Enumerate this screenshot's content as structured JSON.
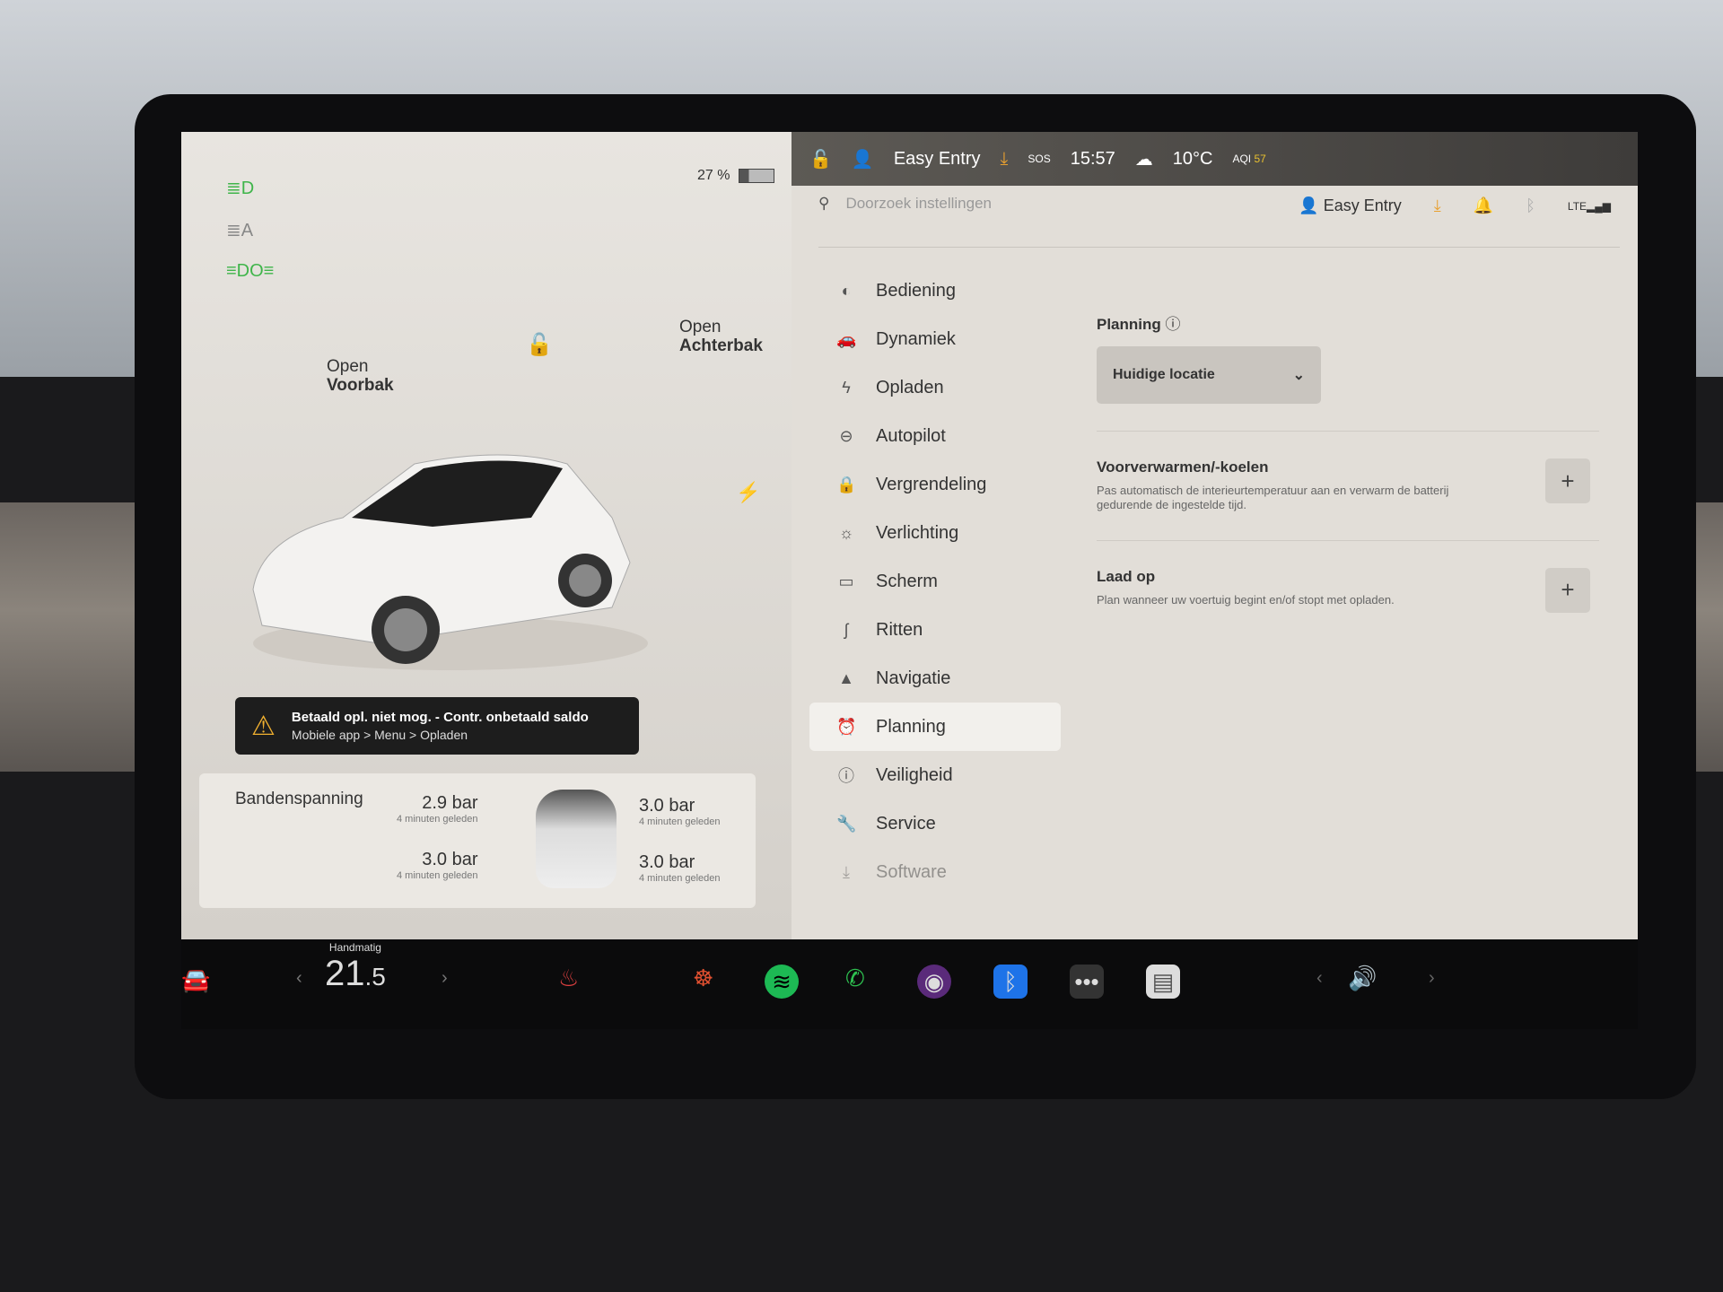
{
  "status": {
    "battery_percent": "27 %",
    "battery_level": 0.27,
    "profile": "Easy Entry",
    "sos": "SOS",
    "time": "15:57",
    "temperature": "10°C",
    "aqi_label": "AQI",
    "aqi_value": "57"
  },
  "search": {
    "placeholder": "Doorzoek instellingen"
  },
  "header": {
    "profile": "Easy Entry"
  },
  "menu": [
    {
      "label": "Bediening",
      "icon": "toggle-icon"
    },
    {
      "label": "Dynamiek",
      "icon": "car-icon"
    },
    {
      "label": "Opladen",
      "icon": "bolt-icon"
    },
    {
      "label": "Autopilot",
      "icon": "steering-wheel-icon"
    },
    {
      "label": "Vergrendeling",
      "icon": "lock-icon"
    },
    {
      "label": "Verlichting",
      "icon": "sun-icon"
    },
    {
      "label": "Scherm",
      "icon": "display-icon"
    },
    {
      "label": "Ritten",
      "icon": "trips-icon"
    },
    {
      "label": "Navigatie",
      "icon": "navigation-icon"
    },
    {
      "label": "Planning",
      "icon": "clock-icon",
      "active": true
    },
    {
      "label": "Veiligheid",
      "icon": "info-circle-icon"
    },
    {
      "label": "Service",
      "icon": "wrench-icon"
    },
    {
      "label": "Software",
      "icon": "download-icon"
    }
  ],
  "planning": {
    "title": "Planning",
    "location": "Huidige locatie",
    "precondition": {
      "title": "Voorverwarmen/-koelen",
      "desc": "Pas automatisch de interieurtemperatuur aan en verwarm de batterij gedurende de ingestelde tijd."
    },
    "charge": {
      "title": "Laad op",
      "desc": "Plan wanneer uw voertuig begint en/of stopt met opladen."
    }
  },
  "car": {
    "frunk_open": "Open",
    "frunk": "Voorbak",
    "trunk_open": "Open",
    "trunk": "Achterbak"
  },
  "alert": {
    "line1": "Betaald opl. niet mog. - Contr. onbetaald saldo",
    "line2": "Mobiele app > Menu > Opladen"
  },
  "tires": {
    "title": "Bandenspanning",
    "fl": {
      "value": "2.9 bar",
      "age": "4 minuten geleden"
    },
    "fr": {
      "value": "3.0 bar",
      "age": "4 minuten geleden"
    },
    "rl": {
      "value": "3.0 bar",
      "age": "4 minuten geleden"
    },
    "rr": {
      "value": "3.0 bar",
      "age": "4 minuten geleden"
    }
  },
  "dock": {
    "climate_mode": "Handmatig",
    "temp_whole": "21",
    "temp_decimal": ".5"
  },
  "colors": {
    "accent_green": "#3fb54a",
    "spotify": "#1db954",
    "bluetooth": "#1e73e8",
    "download": "#e8a030"
  }
}
